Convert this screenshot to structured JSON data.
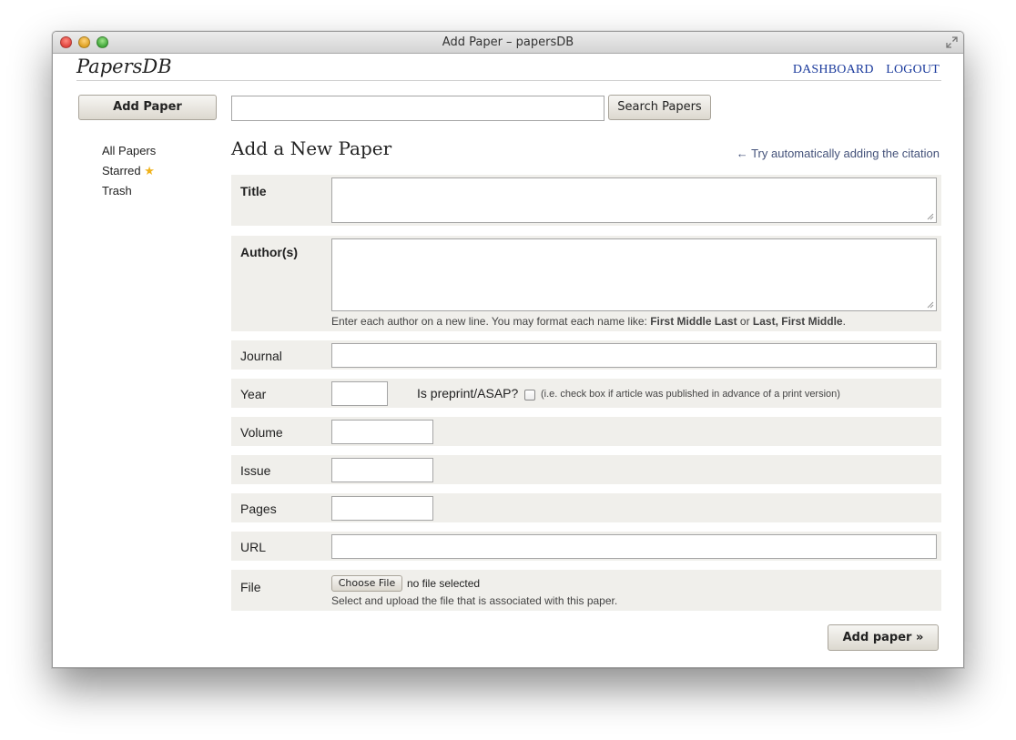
{
  "window": {
    "title": "Add Paper – papersDB"
  },
  "header": {
    "logo": "PapersDB",
    "nav": {
      "dashboard": "DASHBOARD",
      "logout": "LOGOUT"
    }
  },
  "toolbar": {
    "add_paper": "Add Paper",
    "search_button": "Search Papers",
    "search_value": ""
  },
  "sidebar": {
    "items": [
      {
        "label": "All Papers"
      },
      {
        "label": "Starred"
      },
      {
        "label": "Trash"
      }
    ]
  },
  "main": {
    "title": "Add a New Paper",
    "auto_link": "← Try automatically adding the citation"
  },
  "form": {
    "title_label": "Title",
    "authors_label": "Author(s)",
    "authors_hint_prefix": "Enter each author on a new line. You may format each name like: ",
    "authors_hint_format1": "First Middle Last",
    "authors_hint_or": " or ",
    "authors_hint_format2": "Last, First Middle",
    "authors_hint_end": ".",
    "journal_label": "Journal",
    "year_label": "Year",
    "preprint_label": "Is preprint/ASAP?",
    "preprint_note": "(i.e. check box if article was published in advance of a print version)",
    "preprint_checked": false,
    "volume_label": "Volume",
    "issue_label": "Issue",
    "pages_label": "Pages",
    "url_label": "URL",
    "file_label": "File",
    "choose_file": "Choose File",
    "no_file": "no file selected",
    "file_hint": "Select and upload the file that is associated with this paper.",
    "submit": "Add paper »"
  },
  "colors": {
    "link": "#1a3a9c",
    "row_bg": "#f0efeb",
    "star": "#f0b21a"
  },
  "icons": {
    "star": "star-icon",
    "resize": "resize-handle-icon",
    "fullscreen": "fullscreen-icon"
  }
}
